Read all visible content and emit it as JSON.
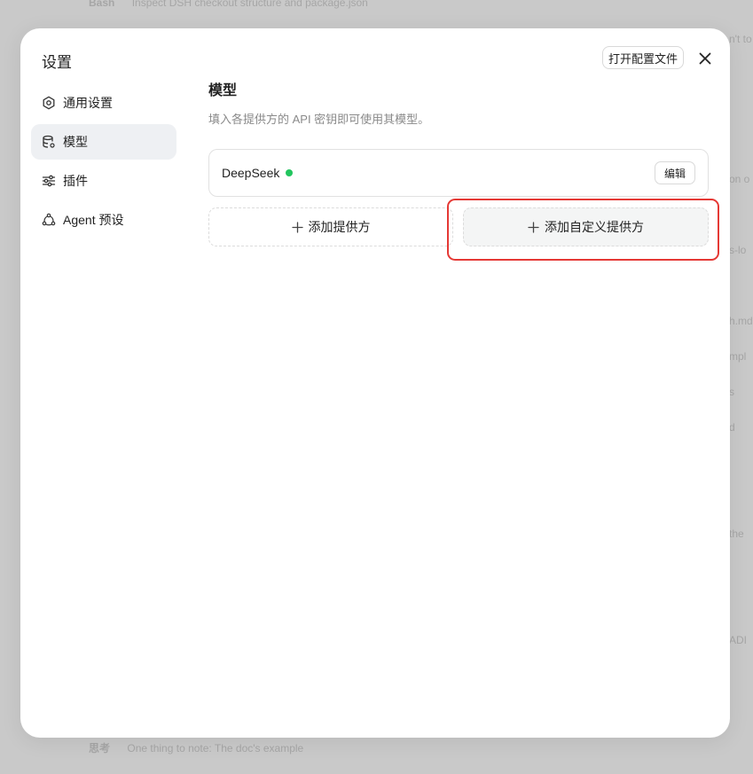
{
  "background": {
    "top_tag": "Bash",
    "top_text": "Inspect DSH checkout structure and package.json",
    "bottom_tag": "思考",
    "bottom_text": "One thing to note: The doc's example",
    "right_fragments": [
      "n't to",
      "on o",
      "s-lo",
      "h.md",
      "mpl",
      "s",
      "d",
      "the",
      "ADI"
    ]
  },
  "modal": {
    "title": "设置",
    "open_config_label": "打开配置文件"
  },
  "sidebar": {
    "items": [
      {
        "label": "通用设置",
        "icon": "gear-icon"
      },
      {
        "label": "模型",
        "icon": "database-icon"
      },
      {
        "label": "插件",
        "icon": "sliders-icon"
      },
      {
        "label": "Agent 预设",
        "icon": "agent-icon"
      }
    ],
    "active_index": 1
  },
  "main": {
    "title": "模型",
    "description": "填入各提供方的 API 密钥即可使用其模型。",
    "providers": [
      {
        "name": "DeepSeek",
        "status_color": "#22c55e",
        "edit_label": "编辑"
      }
    ],
    "add_provider_label": "添加提供方",
    "add_custom_provider_label": "添加自定义提供方"
  },
  "colors": {
    "highlight": "#e53935",
    "status_ok": "#22c55e"
  }
}
